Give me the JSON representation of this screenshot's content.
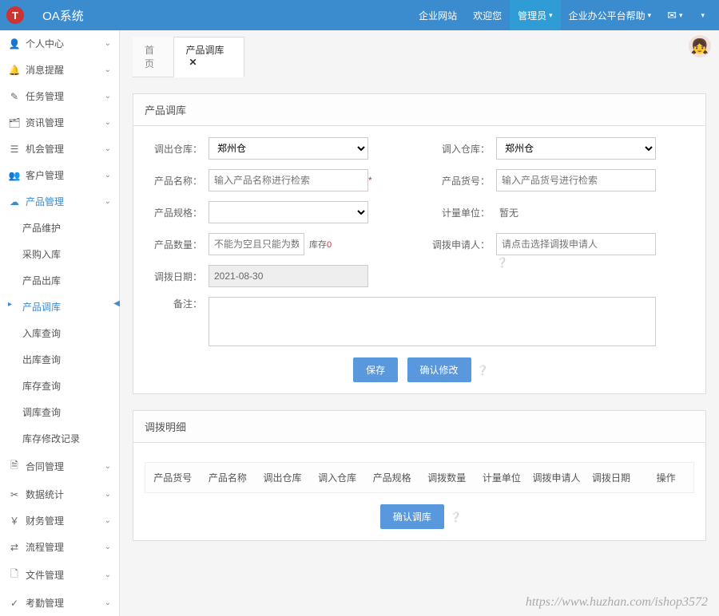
{
  "header": {
    "logo_letter": "T",
    "app_title": "OA系统",
    "nav": {
      "site": "企业网站",
      "welcome": "欢迎您",
      "admin": "管理员",
      "help": "企业办公平台帮助"
    }
  },
  "sidebar": {
    "items": [
      {
        "icon": "👤",
        "label": "个人中心"
      },
      {
        "icon": "🔔",
        "label": "消息提醒"
      },
      {
        "icon": "✎",
        "label": "任务管理"
      },
      {
        "icon": "🗂",
        "label": "资讯管理"
      },
      {
        "icon": "☰",
        "label": "机会管理"
      },
      {
        "icon": "👥",
        "label": "客户管理"
      },
      {
        "icon": "☁",
        "label": "产品管理"
      }
    ],
    "sub": {
      "maint": "产品维护",
      "purchase": "采购入库",
      "out": "产品出库",
      "transfer": "产品调库",
      "inq": "入库查询",
      "outq": "出库查询",
      "stockq": "库存查询",
      "transq": "调库查询",
      "stocklog": "库存修改记录"
    },
    "items2": [
      {
        "icon": "🗎",
        "label": "合同管理"
      },
      {
        "icon": "✂",
        "label": "数据统计"
      },
      {
        "icon": "￥",
        "label": "财务管理"
      },
      {
        "icon": "⇄",
        "label": "流程管理"
      },
      {
        "icon": "🗋",
        "label": "文件管理"
      },
      {
        "icon": "✓",
        "label": "考勤管理"
      }
    ]
  },
  "tabs": {
    "home": "首页",
    "current": "产品调库"
  },
  "panel": {
    "title": "产品调库",
    "labels": {
      "out_wh": "调出仓库：",
      "in_wh": "调入仓库：",
      "pname": "产品名称：",
      "pcode": "产品货号：",
      "spec": "产品规格：",
      "unit": "计量单位：",
      "qty": "产品数量：",
      "stock": "库存",
      "applicant": "调拨申请人：",
      "date": "调拨日期：",
      "remark": "备注："
    },
    "values": {
      "out_wh": "郑州仓",
      "in_wh": "郑州仓",
      "pname_ph": "输入产品名称进行检索",
      "pcode_ph": "输入产品货号进行检索",
      "unit": "暂无",
      "qty_ph": "不能为空且只能为数字",
      "stock_zero": "0",
      "applicant_ph": "请点击选择调拨申请人",
      "date": "2021-08-30"
    },
    "buttons": {
      "save": "保存",
      "confirm_edit": "确认修改"
    }
  },
  "detail": {
    "title": "调拨明细",
    "cols": {
      "code": "产品货号",
      "name": "产品名称",
      "out": "调出仓库",
      "in": "调入仓库",
      "spec": "产品规格",
      "qty": "调拨数量",
      "unit": "计量单位",
      "applicant": "调拨申请人",
      "date": "调拨日期",
      "op": "操作"
    },
    "confirm_btn": "确认调库"
  },
  "watermark": "https://www.huzhan.com/ishop3572"
}
